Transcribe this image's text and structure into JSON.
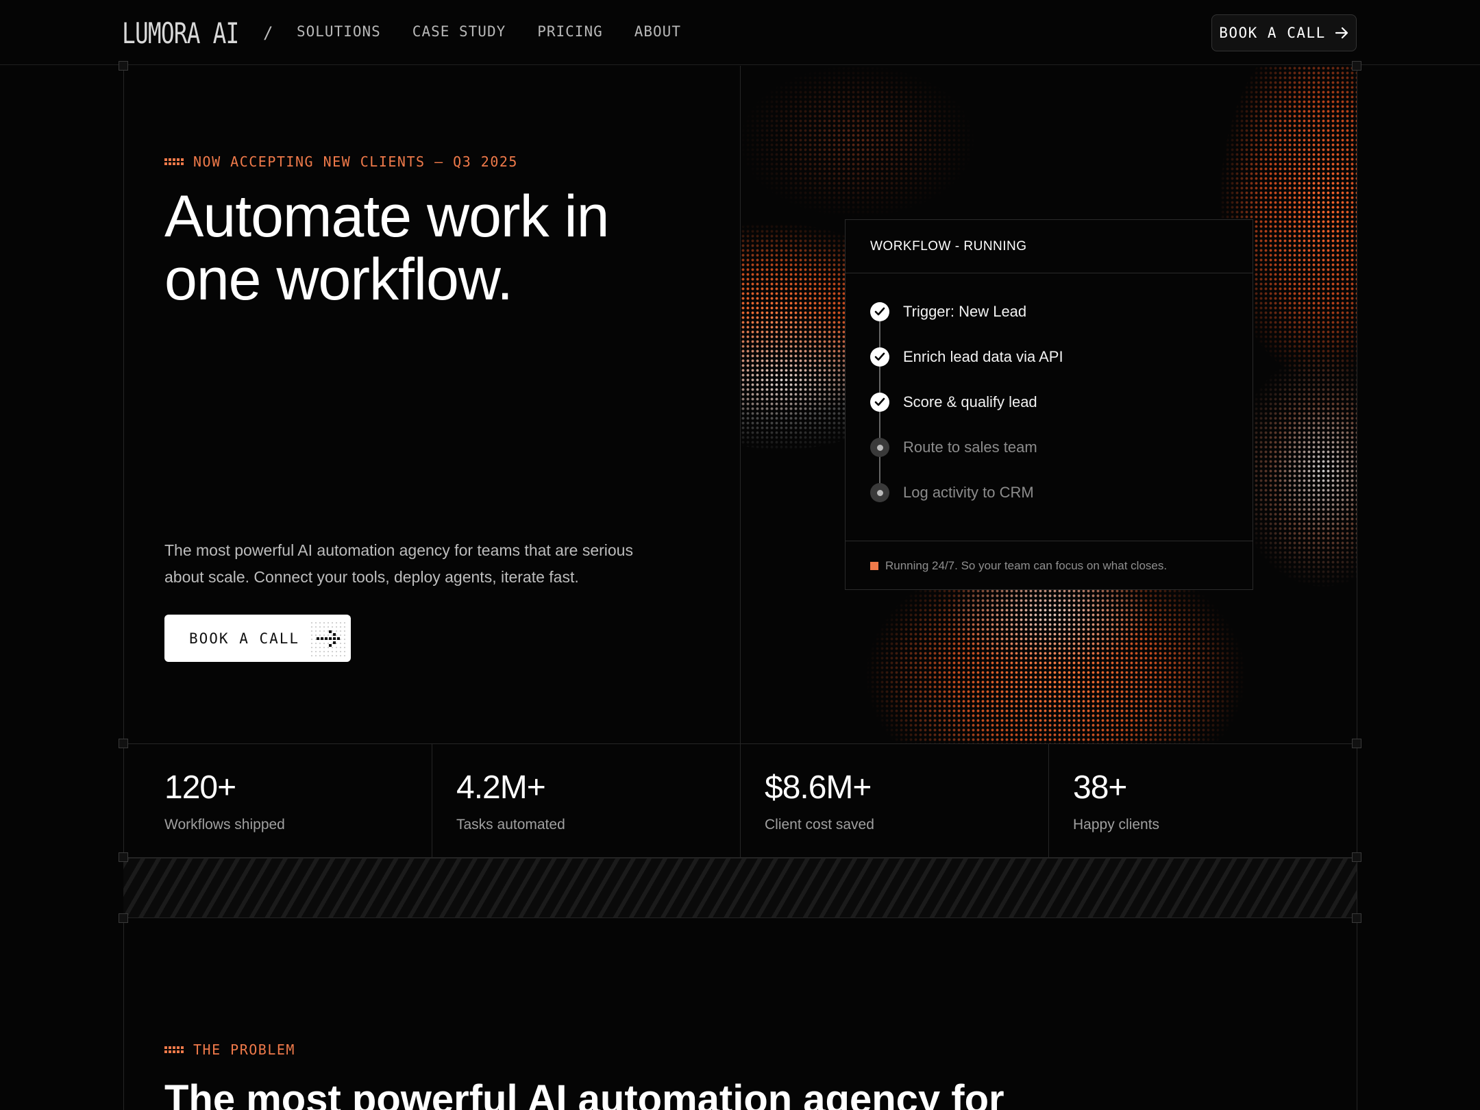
{
  "nav": {
    "logo": "LUMORA AI",
    "separator": "/",
    "links": [
      "SOLUTIONS",
      "CASE STUDY",
      "PRICING",
      "ABOUT"
    ],
    "cta_label": "BOOK A CALL"
  },
  "hero": {
    "eyebrow": "NOW ACCEPTING NEW CLIENTS — Q3 2025",
    "title_line1": "Automate work in",
    "title_line2": "one workflow.",
    "subtitle": "The most powerful AI automation agency for teams that are serious about scale. Connect your tools, deploy agents, iterate fast.",
    "cta_label": "BOOK A CALL"
  },
  "workflow": {
    "header": "WORKFLOW - RUNNING",
    "steps": [
      {
        "label": "Trigger: New Lead",
        "status": "done"
      },
      {
        "label": "Enrich lead data via API",
        "status": "done"
      },
      {
        "label": "Score & qualify lead",
        "status": "done"
      },
      {
        "label": "Route to sales team",
        "status": "pending"
      },
      {
        "label": "Log activity to CRM",
        "status": "pending"
      }
    ],
    "footer": "Running 24/7. So your team can focus on what closes."
  },
  "stats": [
    {
      "value": "120+",
      "label": "Workflows shipped"
    },
    {
      "value": "4.2M+",
      "label": "Tasks automated"
    },
    {
      "value": "$8.6M+",
      "label": "Client cost saved"
    },
    {
      "value": "38+",
      "label": "Happy clients"
    }
  ],
  "problem": {
    "eyebrow": "THE PROBLEM",
    "title": "The most powerful AI automation agency for"
  },
  "colors": {
    "accent": "#f07a4a",
    "background": "#050505"
  }
}
